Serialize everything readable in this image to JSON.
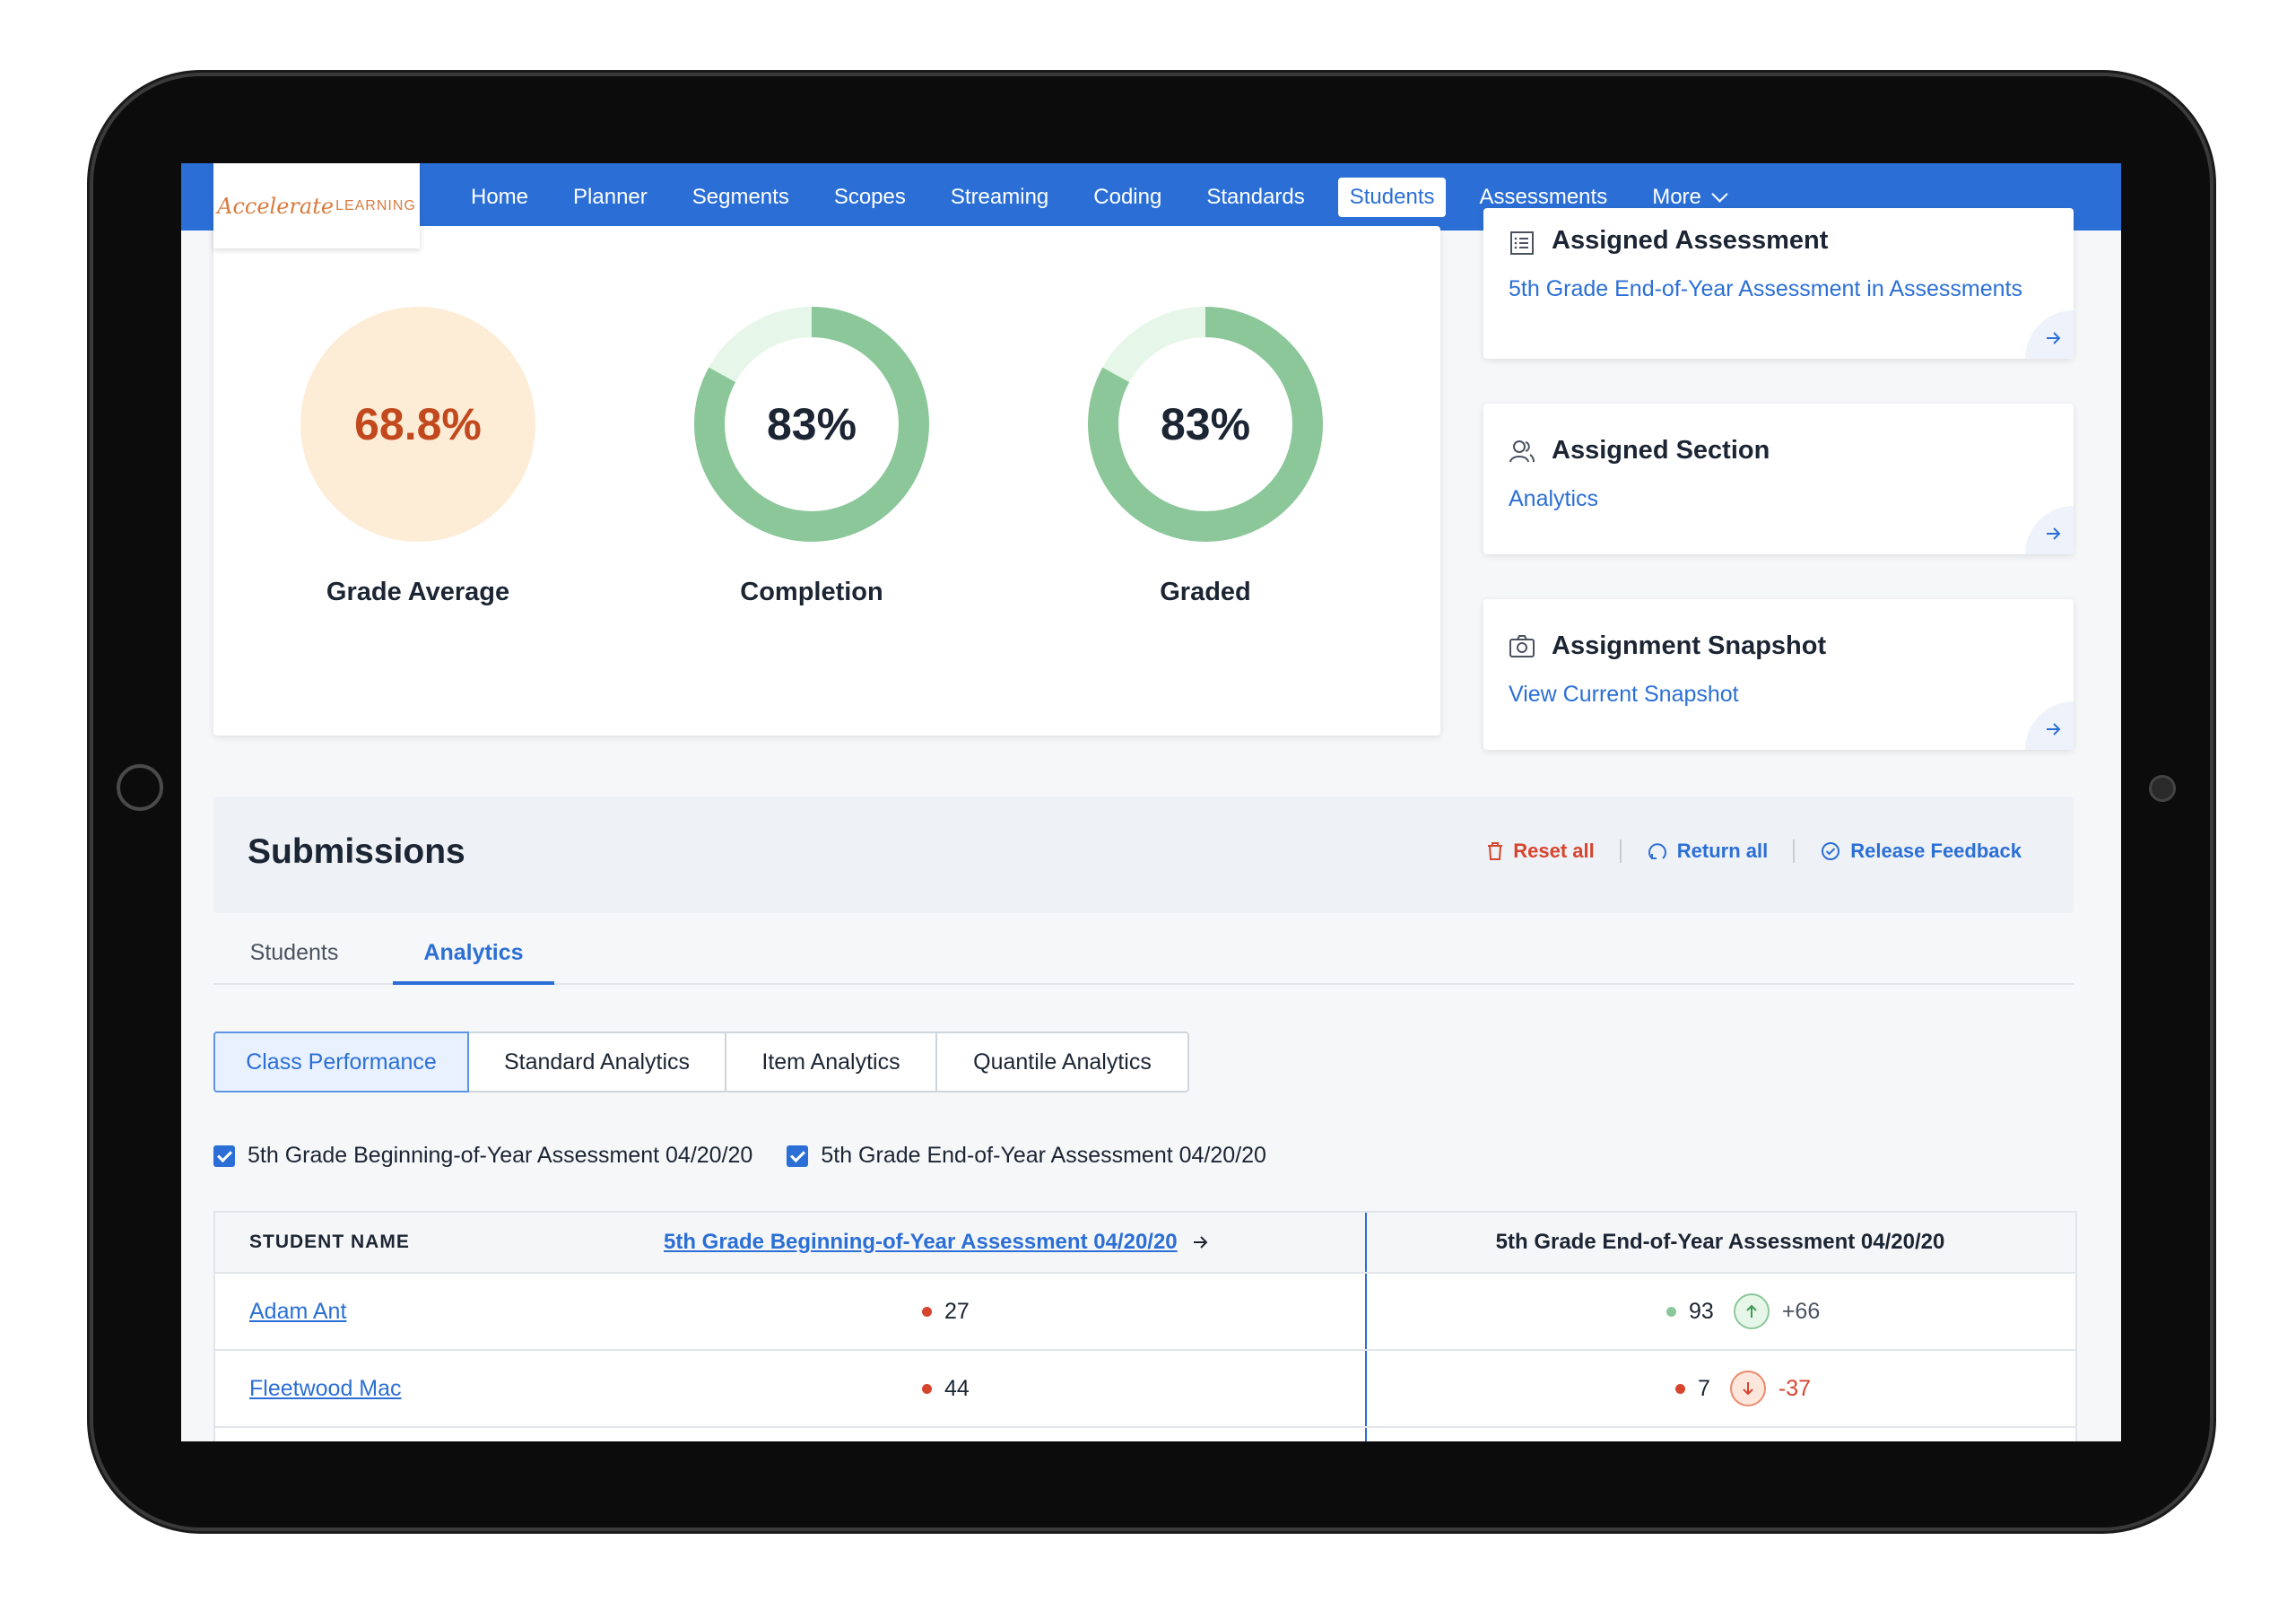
{
  "nav": {
    "logo_script": "Accelerate",
    "logo_caps": "LEARNING",
    "items": [
      "Home",
      "Planner",
      "Segments",
      "Scopes",
      "Streaming",
      "Coding",
      "Standards",
      "Students",
      "Assessments",
      "More"
    ],
    "active": "Students"
  },
  "stats": [
    {
      "value": "68.8%",
      "label": "Grade Average",
      "fraction": 1.0
    },
    {
      "value": "83%",
      "label": "Completion",
      "fraction": 0.83
    },
    {
      "value": "83%",
      "label": "Graded",
      "fraction": 0.83
    }
  ],
  "side_cards": [
    {
      "title": "Assigned Assessment",
      "link": "5th Grade End-of-Year Assessment in Assessments",
      "icon": "list-icon"
    },
    {
      "title": "Assigned Section",
      "link": "Analytics",
      "icon": "users-icon"
    },
    {
      "title": "Assignment Snapshot",
      "link": "View Current Snapshot",
      "icon": "camera-icon"
    }
  ],
  "submissions": {
    "title": "Submissions",
    "reset": "Reset all",
    "return": "Return all",
    "release": "Release Feedback"
  },
  "tabs": [
    "Students",
    "Analytics"
  ],
  "active_tab": "Analytics",
  "segments": [
    "Class Performance",
    "Standard Analytics",
    "Item Analytics",
    "Quantile Analytics"
  ],
  "active_segment": "Class Performance",
  "filters": [
    "5th Grade Beginning-of-Year Assessment 04/20/20",
    "5th Grade End-of-Year Assessment 04/20/20"
  ],
  "table": {
    "col_name": "STUDENT NAME",
    "col_boy": "5th Grade Beginning-of-Year Assessment 04/20/20",
    "col_eoy": "5th Grade End-of-Year Assessment 04/20/20",
    "rows": [
      {
        "name": "Adam Ant",
        "boy": "27",
        "eoy": "93",
        "change": "+66",
        "direction": "up"
      },
      {
        "name": "Fleetwood Mac",
        "boy": "44",
        "eoy": "7",
        "change": "-37",
        "direction": "down"
      }
    ]
  },
  "colors": {
    "brand": "#2b6fd6",
    "green": "#8cc79a",
    "green_light": "#e6f6e8",
    "orange_fill": "#fdecd6",
    "orange_text": "#c2491d",
    "red": "#d6452e"
  }
}
